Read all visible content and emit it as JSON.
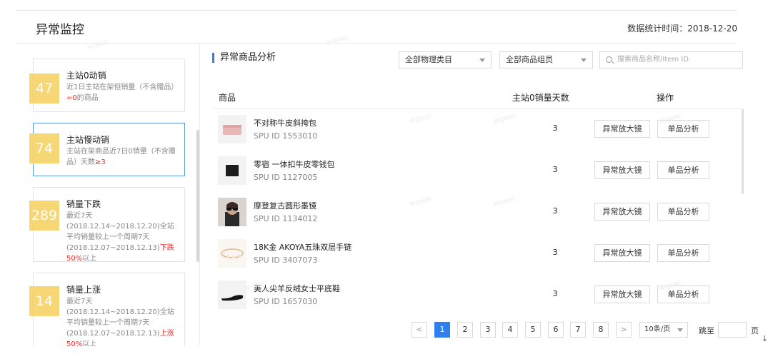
{
  "header": {
    "title": "异常监控",
    "stat_time": "数据统计时间：2018-12-20"
  },
  "sidebar": {
    "metrics": [
      {
        "value": "47",
        "title": "主站0动销",
        "desc_a": "近1日主站在架但销量（不含赠品）",
        "desc_red": "=0",
        "desc_b": "的商品"
      },
      {
        "value": "74",
        "title": "主站慢动销",
        "desc_a": "主站在架商品近7日0销量（不含赠品）天数",
        "desc_red": "≥3",
        "desc_b": ""
      },
      {
        "value": "289",
        "title": "销量下跌",
        "desc_a": "最近7天(2018.12.14~2018.12.20)全站平均销量较上一个周期7天(2018.12.07~2018.12.13)",
        "desc_red": "下跌50%",
        "desc_b": "以上"
      },
      {
        "value": "14",
        "title": "销量上涨",
        "desc_a": "最近7天(2018.12.14~2018.12.20)全站平均销量较上一个周期7天(2018.12.07~2018.12.13)",
        "desc_red": "上涨50%",
        "desc_b": "以上"
      }
    ]
  },
  "main": {
    "section_title": "异常商品分析",
    "filters": {
      "category": "全部物理类目",
      "group": "全部商品组员",
      "search_placeholder": "搜索商品名称/Item ID"
    },
    "columns": {
      "product": "商品",
      "days": "主站0销量天数",
      "action": "操作"
    },
    "actions": {
      "zoom": "异常放大镜",
      "analysis": "单品分析"
    },
    "rows": [
      {
        "name": "不对称牛皮斜挎包",
        "spu": "SPU ID 1553010",
        "days": "3"
      },
      {
        "name": "零宿 一体扣牛皮零钱包",
        "spu": "SPU ID 1127005",
        "days": "3"
      },
      {
        "name": "摩登复古圆形墨镜",
        "spu": "SPU ID 1134012",
        "days": "3"
      },
      {
        "name": "18K金 AKOYA五珠双层手链",
        "spu": "SPU ID 3407073",
        "days": "3"
      },
      {
        "name": "美人尖羊反绒女士平底鞋",
        "spu": "SPU ID 1657030",
        "days": "3"
      }
    ],
    "pagination": {
      "prev": "<",
      "next": ">",
      "pages": [
        "1",
        "2",
        "3",
        "4",
        "5",
        "6",
        "7",
        "8"
      ],
      "current": "1",
      "page_size": "10条/页",
      "jump_label": "跳至",
      "page_suffix": "页"
    }
  },
  "watermark": "wqwei",
  "colors": {
    "accent": "#2f80ed",
    "badge": "#f7d675",
    "alert": "#e5312d"
  }
}
